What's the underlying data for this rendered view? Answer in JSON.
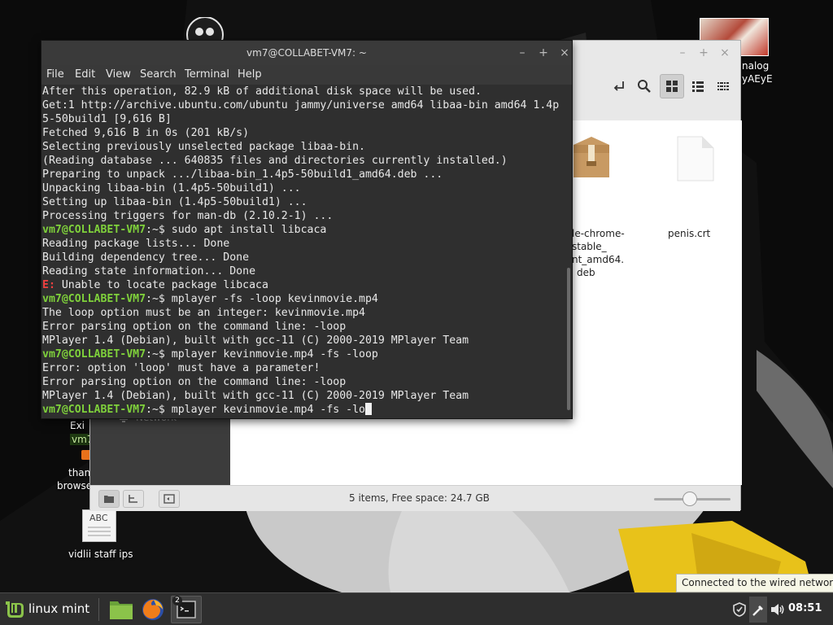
{
  "terminal": {
    "title": "vm7@COLLABET-VM7: ~",
    "menu": [
      "File",
      "Edit",
      "View",
      "Search",
      "Terminal",
      "Help"
    ],
    "prompt": "vm7@COLLABET-VM7",
    "lines": [
      {
        "prompt": "",
        "text": "After this operation, 82.9 kB of additional disk space will be used."
      },
      {
        "prompt": "",
        "text": "Get:1 http://archive.ubuntu.com/ubuntu jammy/universe amd64 libaa-bin amd64 1.4p"
      },
      {
        "prompt": "",
        "text": "5-50build1 [9,616 B]"
      },
      {
        "prompt": "",
        "text": "Fetched 9,616 B in 0s (201 kB/s)"
      },
      {
        "prompt": "",
        "text": "Selecting previously unselected package libaa-bin."
      },
      {
        "prompt": "",
        "text": "(Reading database ... 640835 files and directories currently installed.)"
      },
      {
        "prompt": "",
        "text": "Preparing to unpack .../libaa-bin_1.4p5-50build1_amd64.deb ..."
      },
      {
        "prompt": "",
        "text": "Unpacking libaa-bin (1.4p5-50build1) ..."
      },
      {
        "prompt": "",
        "text": "Setting up libaa-bin (1.4p5-50build1) ..."
      },
      {
        "prompt": "",
        "text": "Processing triggers for man-db (2.10.2-1) ..."
      },
      {
        "prompt": "vm7@COLLABET-VM7",
        "text": ":~$ sudo apt install libcaca"
      },
      {
        "prompt": "",
        "text": "Reading package lists... Done"
      },
      {
        "prompt": "",
        "text": "Building dependency tree... Done"
      },
      {
        "prompt": "",
        "text": "Reading state information... Done"
      },
      {
        "prompt": "",
        "error": "E:",
        "text": " Unable to locate package libcaca"
      },
      {
        "prompt": "vm7@COLLABET-VM7",
        "text": ":~$ mplayer -fs -loop kevinmovie.mp4"
      },
      {
        "prompt": "",
        "text": "The loop option must be an integer: kevinmovie.mp4"
      },
      {
        "prompt": "",
        "text": "Error parsing option on the command line: -loop"
      },
      {
        "prompt": "",
        "text": "MPlayer 1.4 (Debian), built with gcc-11 (C) 2000-2019 MPlayer Team"
      },
      {
        "prompt": "vm7@COLLABET-VM7",
        "text": ":~$ mplayer kevinmovie.mp4 -fs -loop"
      },
      {
        "prompt": "",
        "text": "Error: option 'loop' must have a parameter!"
      },
      {
        "prompt": "",
        "text": "Error parsing option on the command line: -loop"
      },
      {
        "prompt": "",
        "text": "MPlayer 1.4 (Debian), built with gcc-11 (C) 2000-2019 MPlayer Team"
      },
      {
        "prompt": "vm7@COLLABET-VM7",
        "text": ":~$ mplayer kevinmovie.mp4 -fs -lo",
        "cursor": true
      }
    ]
  },
  "file_manager": {
    "items": [
      {
        "label_lines": [
          "le-chrome-",
          "stable_",
          "nt_amd64.",
          "deb"
        ],
        "icon": "package-icon"
      },
      {
        "label_lines": [
          "penis.crt"
        ],
        "icon": "document-icon"
      }
    ],
    "sidebar_partial": "Network",
    "status_text": "5 items, Free space: 24.7 GB",
    "zoom_fraction": 0.47
  },
  "desktop": {
    "icons": [
      {
        "label": "nalog",
        "sublabel": "yAEyE"
      },
      {
        "label": "Exi"
      },
      {
        "label": "vm7"
      },
      {
        "label": "than"
      },
      {
        "label": "browse"
      },
      {
        "label": "vidlii staff ips",
        "icon_text": "ABC"
      }
    ]
  },
  "taskbar": {
    "menu_label": "linux mint",
    "terminal_badge": "2",
    "clock": "08:51"
  },
  "tooltip": "Connected to the wired network",
  "colors": {
    "prompt": "#7fd13b",
    "error": "#ef4040",
    "terminal_bg": "#2f2f2f",
    "mint_green": "#8bc34a"
  }
}
